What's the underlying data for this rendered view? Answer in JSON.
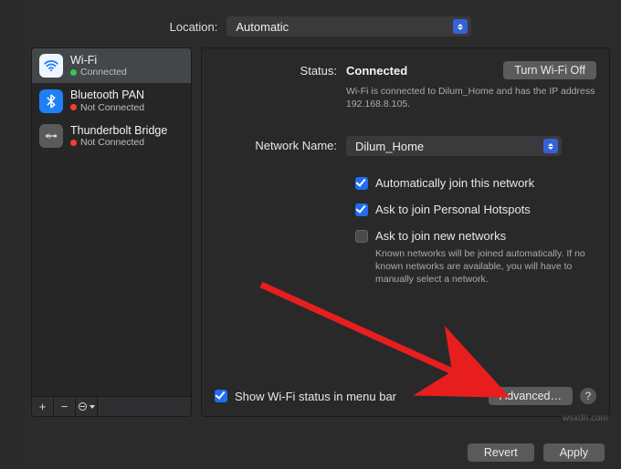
{
  "location": {
    "label": "Location:",
    "value": "Automatic"
  },
  "sidebar": {
    "items": [
      {
        "title": "Wi-Fi",
        "subtitle": "Connected",
        "icon": "wifi",
        "status": "green",
        "selected": true
      },
      {
        "title": "Bluetooth PAN",
        "subtitle": "Not Connected",
        "icon": "bt",
        "status": "red",
        "selected": false
      },
      {
        "title": "Thunderbolt Bridge",
        "subtitle": "Not Connected",
        "icon": "tb",
        "status": "red",
        "selected": false
      }
    ]
  },
  "content": {
    "status_label": "Status:",
    "status_value": "Connected",
    "turn_off_label": "Turn Wi-Fi Off",
    "status_help": "Wi-Fi is connected to Dilum_Home and has the IP address 192.168.8.105.",
    "network_label": "Network Name:",
    "network_value": "Dilum_Home",
    "auto_join_label": "Automatically join this network",
    "auto_join_checked": true,
    "ask_hotspot_label": "Ask to join Personal Hotspots",
    "ask_hotspot_checked": true,
    "ask_new_label": "Ask to join new networks",
    "ask_new_checked": false,
    "ask_new_help": "Known networks will be joined automatically. If no known networks are available, you will have to manually select a network.",
    "show_menubar_label": "Show Wi-Fi status in menu bar",
    "show_menubar_checked": true,
    "advanced_label": "Advanced…",
    "help_label": "?"
  },
  "footer": {
    "revert_label": "Revert",
    "apply_label": "Apply"
  },
  "annotation": {
    "arrow_color": "#e81e1e"
  },
  "watermark": "wsxdn.com"
}
